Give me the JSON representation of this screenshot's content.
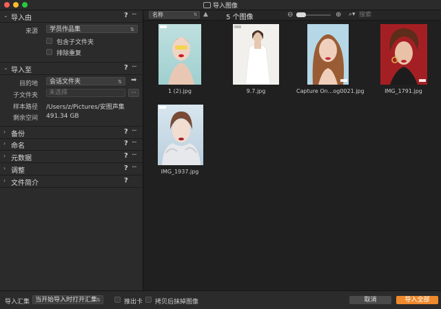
{
  "window": {
    "title": "导入图像",
    "app_icon": "camera-icon"
  },
  "left_panel": {
    "import_from": {
      "title": "导入由",
      "source_label": "来源",
      "source_value": "学员作品集",
      "include_subfolders": "包含子文件夹",
      "exclude_duplicates": "排除重复"
    },
    "import_to": {
      "title": "导入至",
      "destination_label": "目的地",
      "destination_value": "会话文件夹",
      "subfolder_label": "子文件夹",
      "subfolder_placeholder": "未选择",
      "sample_path_label": "样本路径",
      "sample_path_value": "/Users/z/Pictures/安图声集",
      "free_space_label": "剩余空间",
      "free_space_value": "491.34 GB"
    },
    "collapsed_sections": [
      "备份",
      "命名",
      "元数据",
      "调整",
      "文件简介"
    ],
    "help_glyph": "?",
    "more_glyph": "···"
  },
  "toolbar": {
    "sort_value": "名称",
    "count_text": "5 个图像",
    "search_placeholder": "搜索"
  },
  "thumbnails": [
    {
      "filename": "1 (2).jpg"
    },
    {
      "filename": "9.7.jpg"
    },
    {
      "filename": "Capture On...og0021.jpg"
    },
    {
      "filename": "IMG_1791.jpg"
    },
    {
      "filename": "IMG_1937.jpg"
    }
  ],
  "bottom_bar": {
    "collection_label": "导入汇集",
    "collection_value": "当开始导入时打开汇集",
    "eject_card": "推出卡",
    "erase_after_copy": "拷贝后抹掉图像",
    "cancel": "取消",
    "import_all": "导入全部"
  },
  "colors": {
    "accent": "#f08a2c",
    "panel": "#2b2b2b",
    "browser": "#202020"
  }
}
